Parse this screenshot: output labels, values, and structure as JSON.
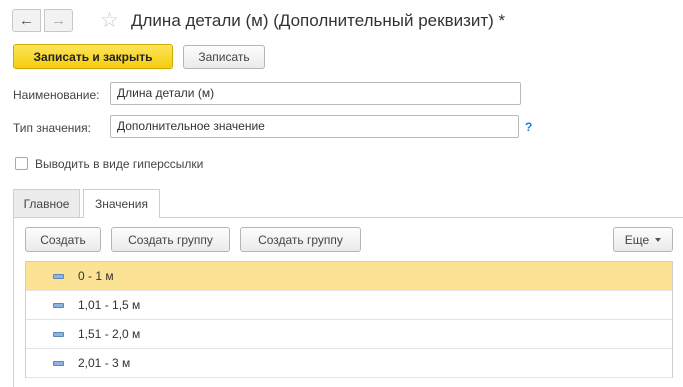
{
  "header": {
    "back_glyph": "←",
    "forward_glyph": "→",
    "favorite_glyph": "☆",
    "title": "Длина детали (м) (Дополнительный реквизит) *"
  },
  "toolbar": {
    "save_close_label": "Записать и закрыть",
    "save_label": "Записать"
  },
  "form": {
    "name_label": "Наименование:",
    "name_value": "Длина детали (м)",
    "type_label": "Тип значения:",
    "type_value": "Дополнительное значение",
    "help_glyph": "?",
    "hyperlink_label": "Выводить в виде гиперссылки",
    "hyperlink_checked": false
  },
  "tabs": [
    {
      "label": "Главное",
      "active": false
    },
    {
      "label": "Значения",
      "active": true
    }
  ],
  "values_toolbar": {
    "create_label": "Создать",
    "create_group_label_1": "Создать группу",
    "create_group_label_2": "Создать группу",
    "more_label": "Еще"
  },
  "values_list": [
    {
      "text": "0 - 1 м",
      "selected": true,
      "icon": "item-icon"
    },
    {
      "text": "1,01 - 1,5 м",
      "selected": false,
      "icon": "item-icon"
    },
    {
      "text": "1,51 - 2,0 м",
      "selected": false,
      "icon": "item-icon"
    },
    {
      "text": "2,01 - 3 м",
      "selected": false,
      "icon": "item-icon"
    }
  ],
  "colors": {
    "primary_button": "#f5cc0e",
    "selected_row": "#fbe295",
    "help": "#2a7bd1"
  }
}
